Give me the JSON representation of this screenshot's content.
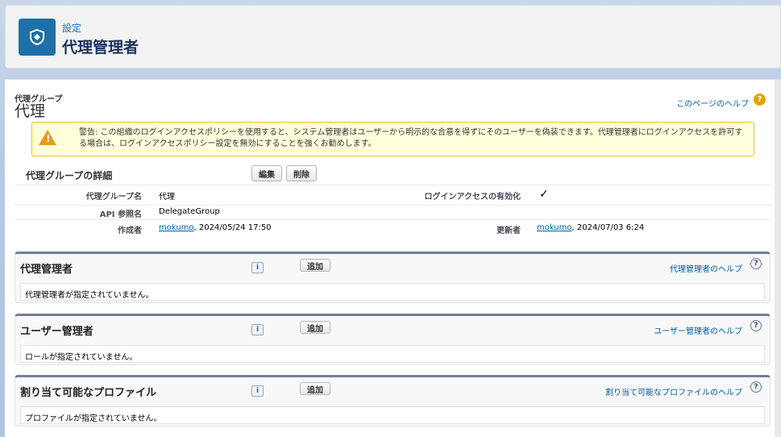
{
  "header": {
    "eyebrow": "設定",
    "title": "代理管理者",
    "icon": "shield-icon"
  },
  "page": {
    "type": "代理グループ",
    "name": "代理",
    "help_link": "このページのヘルプ",
    "help_icon": "?"
  },
  "warning": {
    "text": "警告: この組織のログインアクセスポリシーを使用すると、システム管理者はユーザーから明示的な合意を得ずにそのユーザーを偽装できます。代理管理者にログインアクセスを許可する場合は、ログインアクセスポリシー設定を無効にすることを強くお勧めします。",
    "icon": "warning-icon",
    "icon_glyph": "!"
  },
  "detail": {
    "title": "代理グループの詳細",
    "edit_label": "編集",
    "delete_label": "削除",
    "fields": {
      "group_name_label": "代理グループ名",
      "group_name_value": "代理",
      "login_access_label": "ログインアクセスの有効化",
      "login_access_value": "✓",
      "api_label": "API 参照名",
      "api_value": "DelegateGroup",
      "created_label": "作成者",
      "created_user": "mokumo",
      "created_date": ", 2024/05/24 17:50",
      "modified_label": "更新者",
      "modified_user": "mokumo",
      "modified_date": ", 2024/07/03 6:24"
    }
  },
  "sections": [
    {
      "title": "代理管理者",
      "info": "i",
      "add_label": "追加",
      "help": "代理管理者のヘルプ",
      "q": "?",
      "empty": "代理管理者が指定されていません。"
    },
    {
      "title": "ユーザー管理者",
      "info": "i",
      "add_label": "追加",
      "help": "ユーザー管理者のヘルプ",
      "q": "?",
      "empty": "ロールが指定されていません。"
    },
    {
      "title": "割り当て可能なプロファイル",
      "info": "i",
      "add_label": "追加",
      "help": "割り当て可能なプロファイルのヘルプ",
      "q": "?",
      "empty": "プロファイルが指定されていません。"
    }
  ],
  "colors": {
    "brand": "#1f6fa8",
    "link": "#015ba7",
    "warning_bg": "#ffffdc",
    "warning_border": "#e9c61d"
  }
}
